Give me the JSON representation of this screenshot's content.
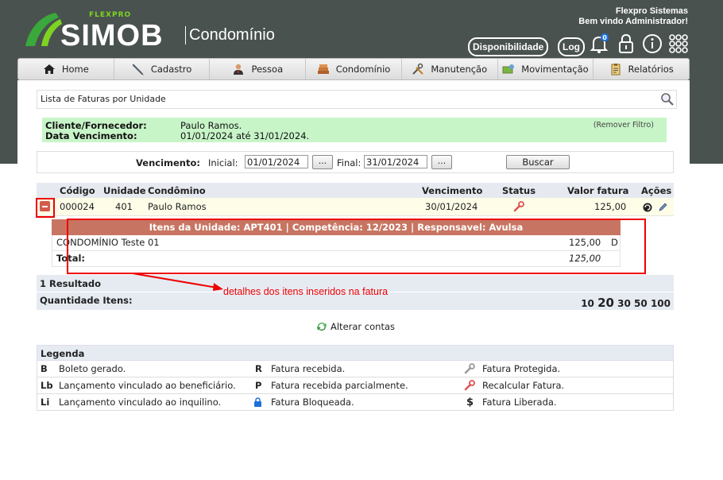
{
  "brand": {
    "flexpro": "FLEXPRO",
    "simob": "SIMOB",
    "module": "Condomínio"
  },
  "user": {
    "company": "Flexpro Sistemas",
    "welcome": "Bem vindo Administrador!"
  },
  "header": {
    "disponibilidade": "Disponibilidade",
    "log": "Log",
    "notifications": "0"
  },
  "menu": [
    {
      "label": "Home",
      "icon": "home-icon"
    },
    {
      "label": "Cadastro",
      "icon": "pencil-icon"
    },
    {
      "label": "Pessoa",
      "icon": "person-icon"
    },
    {
      "label": "Condomínio",
      "icon": "building-icon"
    },
    {
      "label": "Manutenção",
      "icon": "tools-icon"
    },
    {
      "label": "Movimentação",
      "icon": "money-icon"
    },
    {
      "label": "Relatórios",
      "icon": "clipboard-icon"
    }
  ],
  "page": {
    "title": "Lista de Faturas por Unidade"
  },
  "filter": {
    "client_label": "Cliente/Fornecedor:",
    "date_label": "Data Vencimento:",
    "client_value": "Paulo Ramos.",
    "date_value": "01/01/2024 até 31/01/2024.",
    "remove": "(Remover Filtro)"
  },
  "form": {
    "vencimento_label": "Vencimento:",
    "inicial_label": "Inicial:",
    "inicial_value": "01/01/2024",
    "final_label": "Final:",
    "final_value": "31/01/2024",
    "dots": "...",
    "buscar": "Buscar"
  },
  "table": {
    "headers": {
      "codigo": "Código",
      "unidade": "Unidade",
      "condomino": "Condômino",
      "vencimento": "Vencimento",
      "status": "Status",
      "valor": "Valor fatura",
      "acoes": "Ações"
    },
    "rows": [
      {
        "codigo": "000024",
        "unidade": "401",
        "condomino": "Paulo Ramos",
        "vencimento": "30/01/2024",
        "valor": "125,00"
      }
    ]
  },
  "detail": {
    "header": "Itens da Unidade: APT401 | Competência: 12/2023 | Responsavel: Avulsa",
    "items": [
      {
        "name": "CONDOMÍNIO Teste 01",
        "value": "125,00",
        "flag": "D"
      }
    ],
    "total_label": "Total:",
    "total_value": "125,00"
  },
  "results": {
    "count": "1 Resultado",
    "qty_label": "Quantidade Itens:",
    "sizes": [
      "10",
      "20",
      "30",
      "50",
      "100"
    ],
    "selected": "20"
  },
  "annotation": "detalhes dos itens inseridos na fatura",
  "alterar": "Alterar contas",
  "legend": {
    "title": "Legenda",
    "rows": [
      [
        {
          "k": "B",
          "t": "Boleto gerado."
        },
        {
          "k": "R",
          "t": "Fatura recebida."
        },
        {
          "k": "wrench-gray-icon",
          "t": "Fatura Protegida."
        }
      ],
      [
        {
          "k": "Lb",
          "t": "Lançamento vinculado ao beneficiário."
        },
        {
          "k": "P",
          "t": "Fatura recebida parcialmente."
        },
        {
          "k": "wrench-red-icon",
          "t": "Recalcular Fatura."
        }
      ],
      [
        {
          "k": "Li",
          "t": "Lançamento vinculado ao inquilino."
        },
        {
          "k": "lock-icon",
          "t": "Fatura Bloqueada."
        },
        {
          "k": "$",
          "t": "Fatura Liberada."
        }
      ]
    ]
  },
  "colors": {
    "header_bg": "#4a5250",
    "filter_bg": "#c8f5c8",
    "detail_head": "#c77562",
    "annotation": "#ee0000"
  }
}
